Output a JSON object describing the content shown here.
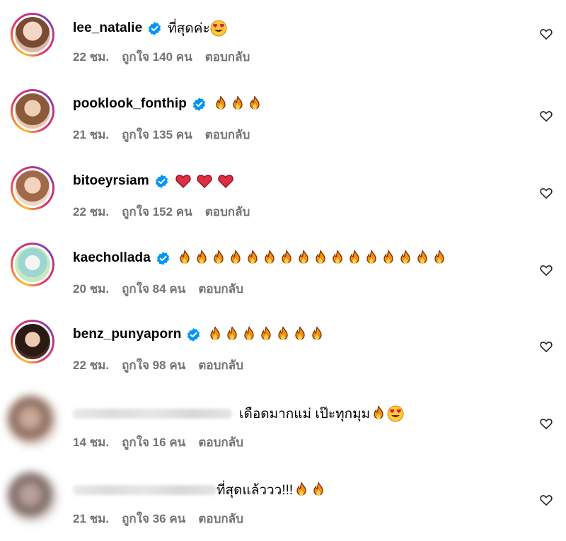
{
  "comments": [
    {
      "username": "lee_natalie",
      "verified": true,
      "text": "ที่สุดค่ะ",
      "emojis": [
        "heart-eyes"
      ],
      "time": "22 ชม.",
      "likes": "ถูกใจ 140 คน",
      "reply": "ตอบกลับ"
    },
    {
      "username": "pooklook_fonthip",
      "verified": true,
      "text": "",
      "emojis": [
        "fire",
        "fire",
        "fire"
      ],
      "time": "21 ชม.",
      "likes": "ถูกใจ 135 คน",
      "reply": "ตอบกลับ"
    },
    {
      "username": "bitoeyrsiam",
      "verified": true,
      "text": "",
      "emojis": [
        "red-heart",
        "red-heart",
        "red-heart"
      ],
      "time": "22 ชม.",
      "likes": "ถูกใจ 152 คน",
      "reply": "ตอบกลับ"
    },
    {
      "username": "kaechollada",
      "verified": true,
      "text": "",
      "emojis": [
        "fire",
        "fire",
        "fire",
        "fire",
        "fire",
        "fire",
        "fire",
        "fire",
        "fire",
        "fire",
        "fire",
        "fire",
        "fire",
        "fire",
        "fire",
        "fire"
      ],
      "time": "20 ชม.",
      "likes": "ถูกใจ 84 คน",
      "reply": "ตอบกลับ"
    },
    {
      "username": "benz_punyaporn",
      "verified": true,
      "text": "",
      "emojis": [
        "fire",
        "fire",
        "fire",
        "fire",
        "fire",
        "fire",
        "fire"
      ],
      "time": "22 ชม.",
      "likes": "ถูกใจ 98 คน",
      "reply": "ตอบกลับ"
    },
    {
      "username": "",
      "verified": false,
      "text": "เดือดมากแม่ เป๊ะทุกมุม ",
      "emojis": [
        "fire",
        "heart-eyes"
      ],
      "time": "14 ชม.",
      "likes": "ถูกใจ 16 คน",
      "reply": "ตอบกลับ"
    },
    {
      "username": "",
      "verified": false,
      "text": "ที่สุดแล้ววว!!!",
      "emojis": [
        "fire",
        "fire"
      ],
      "time": "21 ชม.",
      "likes": "ถูกใจ 36 คน",
      "reply": "ตอบกลับ"
    }
  ],
  "colors": {
    "verified": "#0095f6",
    "meta": "#737373",
    "like_icon": "#262626"
  }
}
